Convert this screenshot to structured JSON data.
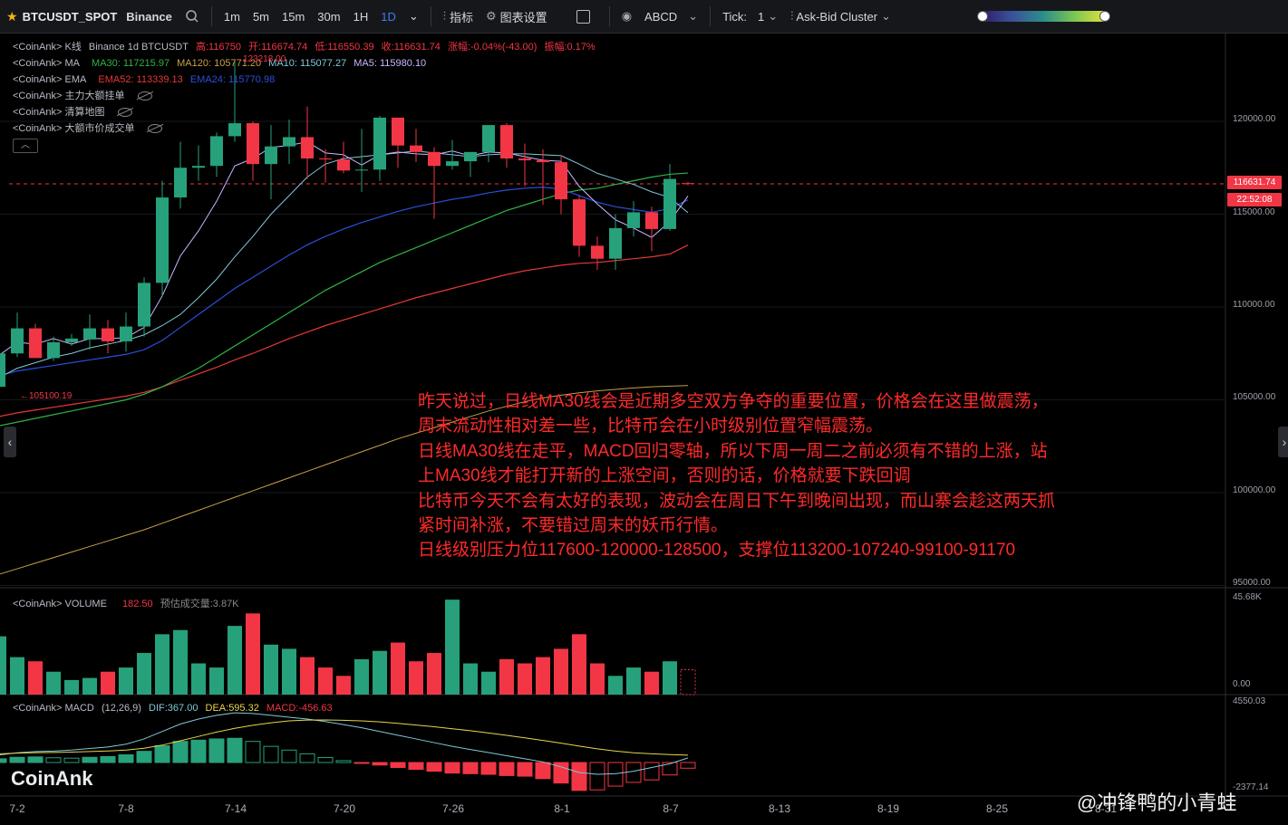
{
  "toolbar": {
    "symbol": "BTCUSDT_SPOT",
    "exchange": "Binance",
    "intervals": [
      "1m",
      "5m",
      "15m",
      "30m",
      "1H",
      "1D"
    ],
    "active_interval": "1D",
    "indicators_label": "指标",
    "chart_settings_label": "图表设置",
    "abcd_label": "ABCD",
    "tick_label": "Tick:",
    "tick_value": "1",
    "cluster_label": "Ask-Bid Cluster"
  },
  "legends": {
    "kline": {
      "prefix": "<CoinAnk> K线",
      "source": "Binance 1d BTCUSDT",
      "high": "高:116750",
      "open": "开:116674.74",
      "low": "低:116550.39",
      "close": "收:116631.74",
      "change": "涨幅:-0.04%(-43.00)",
      "amplitude": "振幅:0.17%"
    },
    "ma": {
      "prefix": "<CoinAnk> MA",
      "ma30": "MA30: 117215.97",
      "ma120": "MA120: 105771.20",
      "ma10": "MA10: 115077.27",
      "ma5": "MA5: 115980.10"
    },
    "ema": {
      "prefix": "<CoinAnk> EMA",
      "ema52": "EMA52: 113339.13",
      "ema24": "EMA24: 115770.98"
    },
    "main_orders": "<CoinAnk> 主力大额挂单",
    "liquidation_map": "<CoinAnk> 清算地图",
    "large_trades": "<CoinAnk> 大额市价成交单",
    "volume": {
      "prefix": "<CoinAnk> VOLUME",
      "value": "182.50",
      "estimate": "预估成交量:3.87K"
    },
    "macd": {
      "prefix": "<CoinAnk> MACD",
      "params": "(12,26,9)",
      "dif": "DIF:367.00",
      "dea": "DEA:595.32",
      "macd": "MACD:-456.63"
    }
  },
  "price_axis": {
    "ticks": [
      "120000.00",
      "115000.00",
      "110000.00",
      "105000.00",
      "100000.00",
      "95000.00"
    ],
    "last_price": "116631.74",
    "countdown": "22:52:08",
    "max_label": "123218.00",
    "min_label": "←105100.19"
  },
  "volume_axis": {
    "ticks": [
      "45.68K",
      "0.00"
    ]
  },
  "macd_axis": {
    "ticks": [
      "4550.03",
      "-2377.14"
    ]
  },
  "x_axis": {
    "ticks": [
      "7-2",
      "7-8",
      "7-14",
      "7-20",
      "7-26",
      "8-1",
      "8-7",
      "8-13",
      "8-19",
      "8-25",
      "8-31"
    ]
  },
  "annotation": [
    "昨天说过，日线MA30线会是近期多空双方争夺的重要位置，价格会在这里做震荡，",
    "周末流动性相对差一些，比特币会在小时级别位置窄幅震荡。",
    "日线MA30线在走平，MACD回归零轴，所以下周一周二之前必须有不错的上涨，站",
    "上MA30线才能打开新的上涨空间，否则的话，价格就要下跌回调",
    "比特币今天不会有太好的表现，波动会在周日下午到晚间出现，而山寨会趁这两天抓",
    "紧时间补涨，不要错过周末的妖币行情。",
    "日线级别压力位117600-120000-128500，支撑位113200-107240-99100-91170"
  ],
  "logo": "CoinAnk",
  "watermark": "@冲锋鸭的小青蛙",
  "colors": {
    "up": "#26a17b",
    "down": "#f23645",
    "ma5": "#c7b7ff",
    "ma10": "#7fc8d8",
    "ma30": "#2fb344",
    "ma120": "#c8a046",
    "ema52": "#e53935",
    "ema24": "#2a4fd9",
    "dif": "#7fc8d8",
    "dea": "#e8d44d"
  },
  "chart_data": {
    "type": "candlestick",
    "x": [
      "7-1",
      "7-2",
      "7-3",
      "7-4",
      "7-5",
      "7-6",
      "7-7",
      "7-8",
      "7-9",
      "7-10",
      "7-11",
      "7-12",
      "7-13",
      "7-14",
      "7-15",
      "7-16",
      "7-17",
      "7-18",
      "7-19",
      "7-20",
      "7-21",
      "7-22",
      "7-23",
      "7-24",
      "7-25",
      "7-26",
      "7-27",
      "7-28",
      "7-29",
      "7-30",
      "7-31",
      "8-1",
      "8-2",
      "8-3",
      "8-4",
      "8-5",
      "8-6",
      "8-7",
      "8-8"
    ],
    "ohlc": [
      [
        105700,
        107600,
        105100,
        107500
      ],
      [
        107500,
        109700,
        107300,
        108850
      ],
      [
        108850,
        109100,
        107300,
        107250
      ],
      [
        107250,
        108400,
        107100,
        108100
      ],
      [
        108100,
        108550,
        107900,
        108300
      ],
      [
        108250,
        109600,
        107700,
        108850
      ],
      [
        108850,
        109300,
        107500,
        108150
      ],
      [
        108150,
        109700,
        107600,
        108950
      ],
      [
        108950,
        111600,
        108400,
        111300
      ],
      [
        111300,
        116800,
        110600,
        115900
      ],
      [
        115900,
        118900,
        115300,
        117500
      ],
      [
        117500,
        118700,
        116800,
        117600
      ],
      [
        117600,
        119400,
        117000,
        119200
      ],
      [
        119200,
        123218,
        118900,
        119900
      ],
      [
        119900,
        120000,
        116800,
        117700
      ],
      [
        117700,
        119800,
        115800,
        118650
      ],
      [
        118650,
        120100,
        117700,
        119150
      ],
      [
        119150,
        120800,
        116900,
        118000
      ],
      [
        118000,
        118500,
        116700,
        117950
      ],
      [
        117950,
        118900,
        117200,
        117350
      ],
      [
        117350,
        119600,
        116200,
        117400
      ],
      [
        117400,
        120300,
        116800,
        120200
      ],
      [
        120200,
        120200,
        117500,
        118700
      ],
      [
        118700,
        119600,
        117800,
        118350
      ],
      [
        118350,
        118600,
        114750,
        117600
      ],
      [
        117600,
        119000,
        117400,
        117850
      ],
      [
        117850,
        118300,
        117000,
        118350
      ],
      [
        118350,
        119800,
        117800,
        119800
      ],
      [
        119800,
        119900,
        117500,
        118000
      ],
      [
        118000,
        118800,
        116500,
        117900
      ],
      [
        117900,
        118500,
        115500,
        117800
      ],
      [
        117800,
        118100,
        115000,
        115800
      ],
      [
        115800,
        116000,
        112700,
        113300
      ],
      [
        113300,
        113800,
        112000,
        112600
      ],
      [
        112600,
        115000,
        112000,
        114250
      ],
      [
        114250,
        115700,
        113800,
        115100
      ],
      [
        115100,
        115400,
        113000,
        114200
      ],
      [
        114200,
        117700,
        114100,
        116900
      ],
      [
        116674.74,
        116750,
        116550.39,
        116631.74
      ]
    ],
    "volume": [
      28000,
      18000,
      16000,
      11000,
      7000,
      8000,
      11000,
      13000,
      20000,
      29000,
      31000,
      15000,
      13000,
      33000,
      39000,
      24000,
      22000,
      18000,
      13000,
      9000,
      17000,
      21000,
      25000,
      16000,
      20000,
      45600,
      15000,
      11000,
      17000,
      15000,
      18000,
      22000,
      29000,
      15000,
      9000,
      13000,
      11000,
      16000,
      12000
    ],
    "ma5": [
      107400,
      108100,
      108000,
      108300,
      108000,
      108300,
      108300,
      108350,
      108900,
      110600,
      112750,
      114100,
      115700,
      117600,
      118000,
      118600,
      118700,
      118900,
      118300,
      118200,
      117650,
      118200,
      118350,
      118250,
      118200,
      118400,
      118150,
      118350,
      118300,
      118100,
      117900,
      117850,
      116500,
      115550,
      114700,
      114250,
      113750,
      114600,
      115980
    ],
    "ma10": [
      106200,
      106700,
      107000,
      107300,
      107500,
      107800,
      108000,
      108200,
      108500,
      109000,
      109600,
      110500,
      111500,
      112700,
      113800,
      115000,
      116000,
      117000,
      117700,
      118000,
      118100,
      118200,
      118300,
      118400,
      118300,
      118200,
      118100,
      118200,
      118250,
      118250,
      118200,
      118150,
      117700,
      117200,
      116900,
      116600,
      116200,
      115900,
      115077
    ],
    "ma30": [
      103600,
      103800,
      104000,
      104200,
      104400,
      104600,
      104800,
      105000,
      105300,
      105700,
      106200,
      106700,
      107300,
      107900,
      108500,
      109100,
      109700,
      110300,
      110900,
      111400,
      111900,
      112400,
      112800,
      113200,
      113600,
      114000,
      114400,
      114800,
      115200,
      115500,
      115800,
      116100,
      116300,
      116400,
      116600,
      116800,
      117000,
      117150,
      117216
    ],
    "ma120": [
      95600,
      95900,
      96200,
      96500,
      96800,
      97100,
      97400,
      97700,
      98000,
      98350,
      98700,
      99050,
      99400,
      99750,
      100100,
      100450,
      100800,
      101150,
      101500,
      101850,
      102200,
      102550,
      102900,
      103200,
      103500,
      103800,
      104100,
      104400,
      104650,
      104900,
      105100,
      105250,
      105380,
      105480,
      105560,
      105640,
      105700,
      105740,
      105771
    ],
    "ema52": [
      104100,
      104300,
      104450,
      104600,
      104750,
      104900,
      105050,
      105200,
      105400,
      105700,
      106050,
      106400,
      106750,
      107150,
      107500,
      107900,
      108300,
      108650,
      109000,
      109300,
      109600,
      109900,
      110200,
      110500,
      110750,
      111000,
      111250,
      111500,
      111750,
      111950,
      112100,
      112250,
      112350,
      112400,
      112500,
      112600,
      112700,
      112850,
      113339
    ],
    "ema24": [
      106300,
      106550,
      106700,
      106850,
      107000,
      107150,
      107300,
      107450,
      107700,
      108200,
      108900,
      109600,
      110300,
      111000,
      111600,
      112200,
      112800,
      113350,
      113800,
      114200,
      114550,
      114850,
      115150,
      115400,
      115600,
      115800,
      115950,
      116150,
      116300,
      116400,
      116450,
      116350,
      116000,
      115650,
      115400,
      115250,
      115100,
      115300,
      115771
    ],
    "macd_hist": [
      300,
      420,
      450,
      380,
      350,
      420,
      480,
      620,
      900,
      1350,
      1700,
      1800,
      1900,
      1950,
      1700,
      1300,
      1000,
      700,
      400,
      150,
      -50,
      -200,
      -400,
      -550,
      -700,
      -850,
      -900,
      -950,
      -1050,
      -1100,
      -1300,
      -1650,
      -2250,
      -2200,
      -1900,
      -1600,
      -1400,
      -1000,
      -457
    ],
    "macd_dif": [
      600,
      780,
      880,
      920,
      1000,
      1130,
      1250,
      1480,
      1900,
      2500,
      3100,
      3500,
      3800,
      4000,
      3950,
      3800,
      3650,
      3500,
      3300,
      3050,
      2800,
      2500,
      2200,
      1900,
      1600,
      1300,
      1050,
      800,
      550,
      300,
      50,
      -350,
      -800,
      -950,
      -900,
      -700,
      -400,
      -100,
      367
    ],
    "macd_dea": [
      700,
      760,
      790,
      810,
      840,
      880,
      930,
      1000,
      1150,
      1400,
      1750,
      2100,
      2450,
      2750,
      3000,
      3200,
      3350,
      3420,
      3430,
      3400,
      3350,
      3270,
      3150,
      3020,
      2880,
      2720,
      2560,
      2380,
      2190,
      1990,
      1780,
      1560,
      1320,
      1100,
      920,
      780,
      700,
      640,
      595
    ],
    "price_range": [
      95000,
      123218
    ],
    "volume_range": [
      0,
      45680
    ],
    "macd_range": [
      -2377.14,
      4550.03
    ]
  }
}
